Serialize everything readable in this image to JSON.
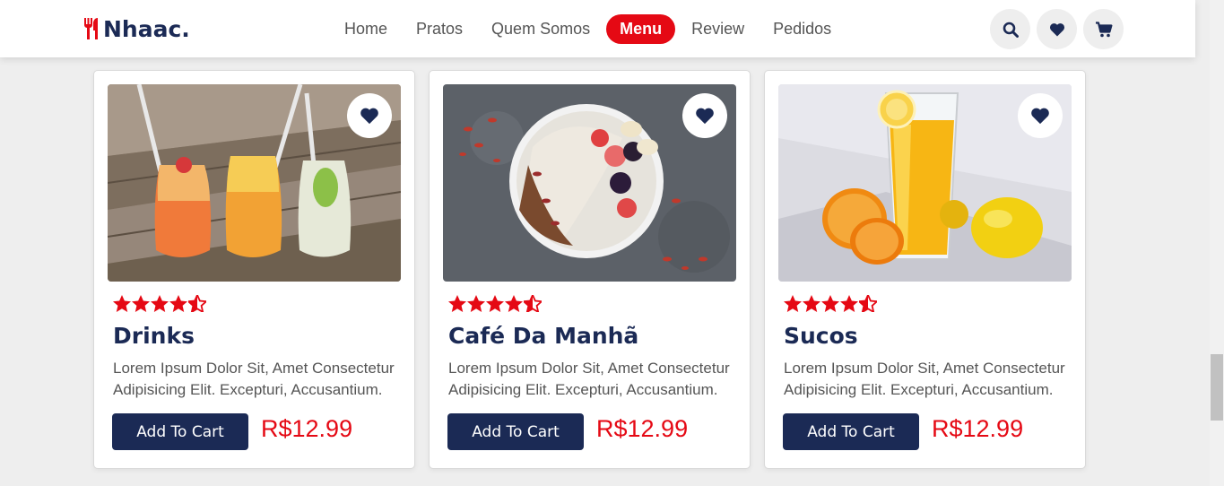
{
  "header": {
    "logo_text": "Nhaac.",
    "logo_icon": "utensils-icon",
    "nav": [
      "Home",
      "Pratos",
      "Quem Somos",
      "Menu",
      "Review",
      "Pedidos"
    ],
    "active_nav": "Menu",
    "icons": [
      "search-icon",
      "heart-icon",
      "cart-icon"
    ]
  },
  "colors": {
    "brand_red": "#e50914",
    "navy": "#1b2a55"
  },
  "cards": [
    {
      "title": "Drinks",
      "desc": "Lorem Ipsum Dolor Sit, Amet Consectetur Adipisicing Elit. Excepturi, Accusantium.",
      "button": "Add To Cart",
      "price": "R$12.99",
      "rating": 4.5
    },
    {
      "title": "Café Da Manhã",
      "desc": "Lorem Ipsum Dolor Sit, Amet Consectetur Adipisicing Elit. Excepturi, Accusantium.",
      "button": "Add To Cart",
      "price": "R$12.99",
      "rating": 4.5
    },
    {
      "title": "Sucos",
      "desc": "Lorem Ipsum Dolor Sit, Amet Consectetur Adipisicing Elit. Excepturi, Accusantium.",
      "button": "Add To Cart",
      "price": "R$12.99",
      "rating": 4.5
    }
  ]
}
